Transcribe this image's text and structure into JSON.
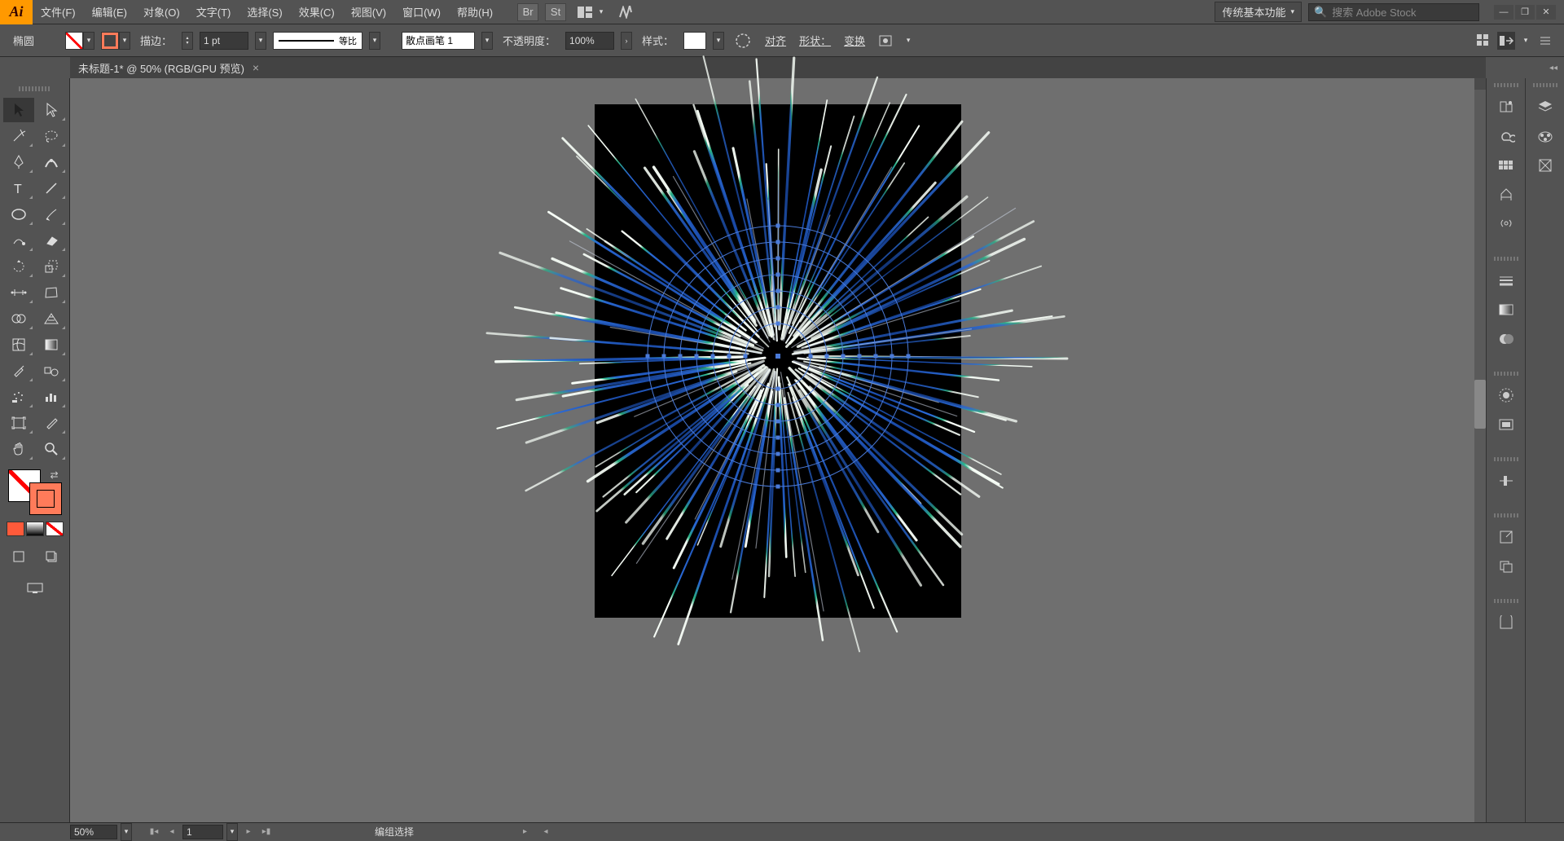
{
  "app": {
    "logo": "Ai"
  },
  "menu": {
    "items": [
      "文件(F)",
      "编辑(E)",
      "对象(O)",
      "文字(T)",
      "选择(S)",
      "效果(C)",
      "视图(V)",
      "窗口(W)",
      "帮助(H)"
    ]
  },
  "workspace": {
    "label": "传统基本功能"
  },
  "search": {
    "placeholder": "搜索 Adobe Stock"
  },
  "control": {
    "shape_label": "椭圆",
    "stroke_label": "描边：",
    "weight": "1 pt",
    "brush_profile": "等比",
    "brush_name": "散点画笔 1",
    "opacity_label": "不透明度：",
    "opacity": "100%",
    "style_label": "样式：",
    "align_label": "对齐",
    "shape_btn": "形状：",
    "transform_label": "变换"
  },
  "tab": {
    "title": "未标题-1* @ 50% (RGB/GPU 预览)"
  },
  "status": {
    "zoom": "50%",
    "artboard": "1",
    "selection": "编组选择"
  }
}
